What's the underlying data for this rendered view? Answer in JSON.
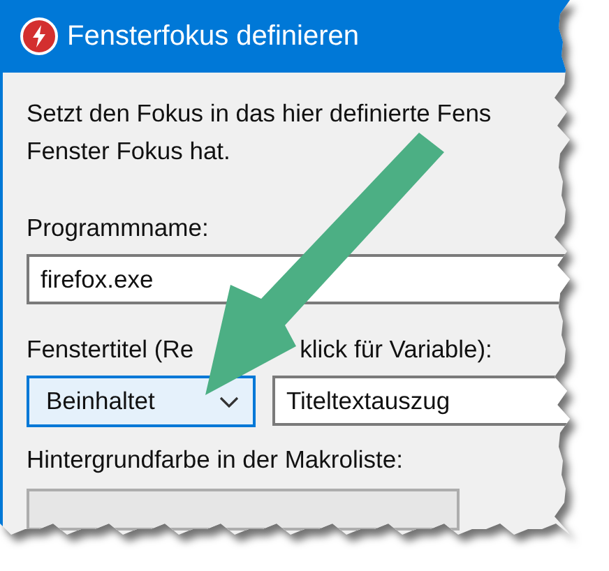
{
  "window": {
    "title": "Fensterfokus definieren"
  },
  "description_lines": [
    "Setzt den Fokus in das hier definierte Fens",
    "Fenster Fokus hat."
  ],
  "program_name": {
    "label": "Programmname:",
    "value": "firefox.exe"
  },
  "window_title": {
    "label_parts": [
      "Fenstertitel (Re",
      "klick für Variable):"
    ],
    "match_mode": "Beinhaltet",
    "match_mode_focused": true,
    "value": "Titeltextauszug"
  },
  "background_color": {
    "label": "Hintergrundfarbe in der Makroliste:"
  }
}
